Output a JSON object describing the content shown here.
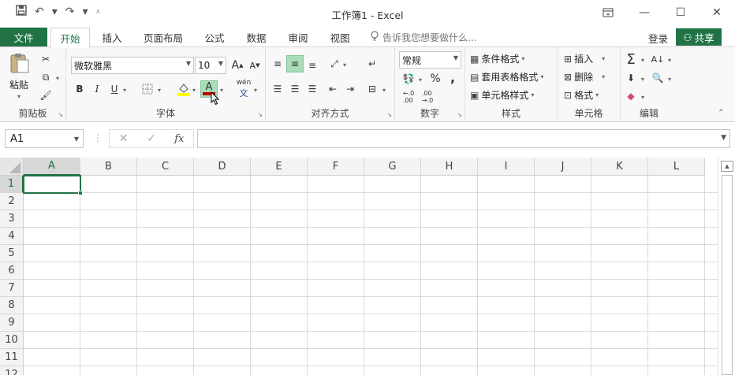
{
  "window": {
    "title": "工作簿1 - Excel",
    "qat": {
      "save_icon": "save-icon",
      "undo_icon": "undo-icon",
      "redo_icon": "redo-icon",
      "customize_icon": "customize-qat-icon"
    },
    "controls": {
      "ribbon_display": "ribbon-display-icon",
      "minimize": "minimize-icon",
      "maximize": "maximize-icon",
      "close": "close-icon"
    }
  },
  "tabs": {
    "file": "文件",
    "items": [
      "开始",
      "插入",
      "页面布局",
      "公式",
      "数据",
      "审阅",
      "视图"
    ],
    "active": "开始",
    "tell_me_placeholder": "告诉我您想要做什么...",
    "login": "登录",
    "share": "共享"
  },
  "ribbon": {
    "clipboard": {
      "label": "剪贴板",
      "paste": "粘贴"
    },
    "font": {
      "label": "字体",
      "font_name": "微软雅黑",
      "font_size": "10",
      "bold": "B",
      "italic": "I",
      "underline": "U",
      "font_color_letter": "A",
      "phonetic": "wén"
    },
    "alignment": {
      "label": "对齐方式"
    },
    "number": {
      "label": "数字",
      "format": "常规",
      "percent": "%",
      "comma": ","
    },
    "styles": {
      "label": "样式",
      "conditional": "条件格式",
      "table": "套用表格格式",
      "cell_styles": "单元格样式"
    },
    "cells": {
      "label": "单元格",
      "insert": "插入",
      "delete": "删除",
      "format": "格式"
    },
    "editing": {
      "label": "编辑"
    }
  },
  "formula_bar": {
    "name_box": "A1",
    "fx": "fx",
    "formula": ""
  },
  "sheet": {
    "columns": [
      "A",
      "B",
      "C",
      "D",
      "E",
      "F",
      "G",
      "H",
      "I",
      "J",
      "K",
      "L"
    ],
    "rows": [
      "1",
      "2",
      "3",
      "4",
      "5",
      "6",
      "7",
      "8",
      "9",
      "10",
      "11",
      "12"
    ],
    "active_cell": "A1"
  },
  "colors": {
    "accent": "#217346",
    "selected_button": "#a9dcb8"
  }
}
